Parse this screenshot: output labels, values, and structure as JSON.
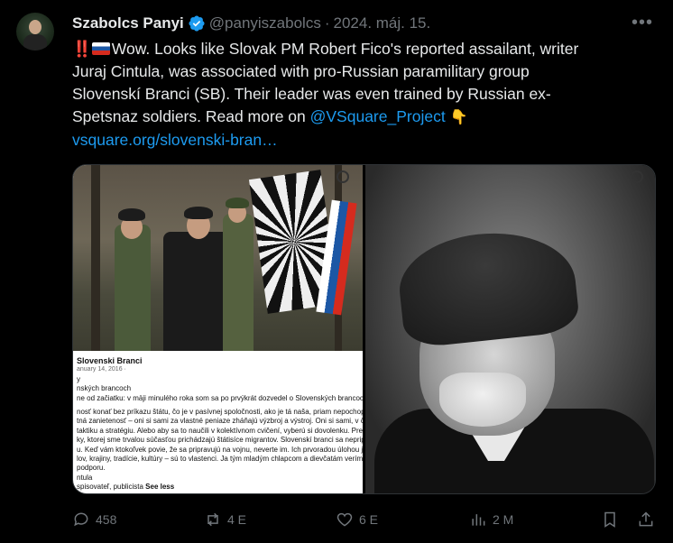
{
  "author": {
    "name": "Szabolcs Panyi",
    "handle": "@panyiszabolcs",
    "separator": "·",
    "date": "2024. máj. 15."
  },
  "tweet": {
    "prefix": "‼️",
    "line1_text": "Wow. Looks like Slovak PM Robert Fico's reported assailant, writer",
    "line2": "Juraj Cintula, was associated with pro-Russian paramilitary group",
    "line3": "Slovenskí Branci (SB). Their leader was even trained by Russian ex-",
    "line4_text": "Spetsnaz soldiers. Read more on ",
    "mention": "@VSquare_Project",
    "pointing_emoji": "👇",
    "link_text": "vsquare.org/slovenski-bran…"
  },
  "media": {
    "post": {
      "page_name": "Slovenski Branci",
      "page_date": "anuary 14, 2016 · ",
      "lines": [
        "y",
        "nských brancoch",
        "ne od začiatku: v mäji minulého roka som sa po prvýkrát dozvedel o Slovenských brancoch a čo ma",
        "",
        "nosť konať bez príkazu štátu, čo je v pasívnej spoločnosti, ako je tá naša, priam nepochopiteľné.",
        "tná zanietenosť – oni si sami za vlastné peniaze zháňajú výzbroj a výstroj. Oni si sami, v čase svojho",
        "taktiku a stratégiu. Alebo aby sa to naučili v kolektívnom cvičení, vyberú si dovolenku. Preto to rob",
        "ky, ktorej sme trvalou súčasťou prichádzajú štátisíce migrantov. Slovenskí branci sa nepripravujú na",
        "u. Keď vám ktokoľvek povie, že sa pripravujú na vojnu, neverte im. Ich prvoradou úlohou je ochrana",
        "lov, krajiny, tradície, kultúry – sú to vlastenci. Ja tým mladým chlapcom a dievčatám verím a vyjadru",
        "podporu.",
        "ntula",
        "spisovateľ, publicista "
      ],
      "see_less": "See less"
    }
  },
  "actions": {
    "replies": "458",
    "reposts": "4 E",
    "likes": "6 E",
    "views": "2 M"
  },
  "colors": {
    "background": "#000000",
    "text": "#e7e9ea",
    "muted": "#71767b",
    "link": "#1d9bf0",
    "verified": "#1d9bf0"
  },
  "icons": [
    "verified-badge-icon",
    "more-icon",
    "reply-icon",
    "repost-icon",
    "like-icon",
    "views-icon",
    "bookmark-icon",
    "share-icon",
    "zoom-icon"
  ]
}
